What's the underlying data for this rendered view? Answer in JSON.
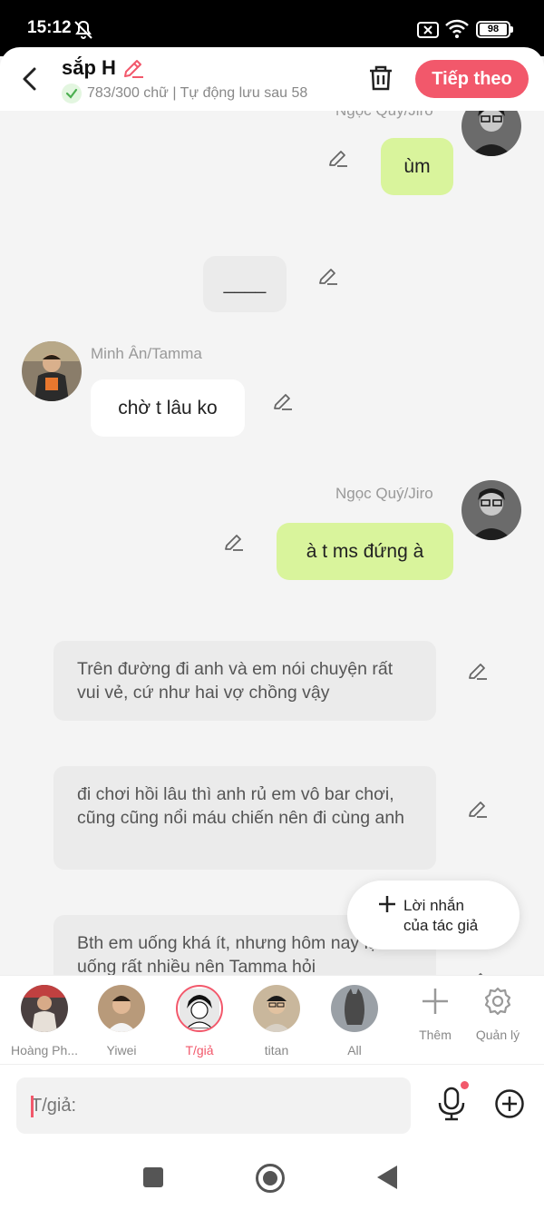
{
  "status_bar": {
    "time": "15:12",
    "battery": "98"
  },
  "header": {
    "title": "sắp H",
    "subtitle": "783/300 chữ | Tự động lưu sau 58",
    "next_label": "Tiếp theo"
  },
  "messages": [
    {
      "speaker": "Ngọc Quý/Jiro",
      "text": "ùm"
    },
    {
      "text": "____"
    },
    {
      "speaker": "Minh Ân/Tamma",
      "text": "chờ t lâu ko"
    },
    {
      "speaker": "Ngọc Quý/Jiro",
      "text": "à t ms đứng à"
    },
    {
      "text": "Trên đường đi anh và em nói chuyện rất vui vẻ, cứ như hai vợ chồng vậy"
    },
    {
      "text": "đi chơi hồi lâu thì anh rủ em vô bar chơi,  cũng cũng nổi máu chiến nên đi cùng anh"
    },
    {
      "text": "Bth em uống khá ít, nhưng hôm nay lại uống rất nhiều nên Tamma hỏi"
    }
  ],
  "fab": {
    "line1": "Lời nhắn",
    "line2": "của tác giả"
  },
  "characters": [
    {
      "label": "Hoàng Ph..."
    },
    {
      "label": "Yiwei"
    },
    {
      "label": "T/giả"
    },
    {
      "label": "titan"
    },
    {
      "label": "All"
    }
  ],
  "tools": {
    "add_label": "Thêm",
    "manage_label": "Quản lý"
  },
  "input": {
    "placeholder": "T/giả:"
  },
  "colors": {
    "accent": "#f2586b",
    "green_bubble": "#d9f49c",
    "narration_bg": "#ebebeb"
  }
}
